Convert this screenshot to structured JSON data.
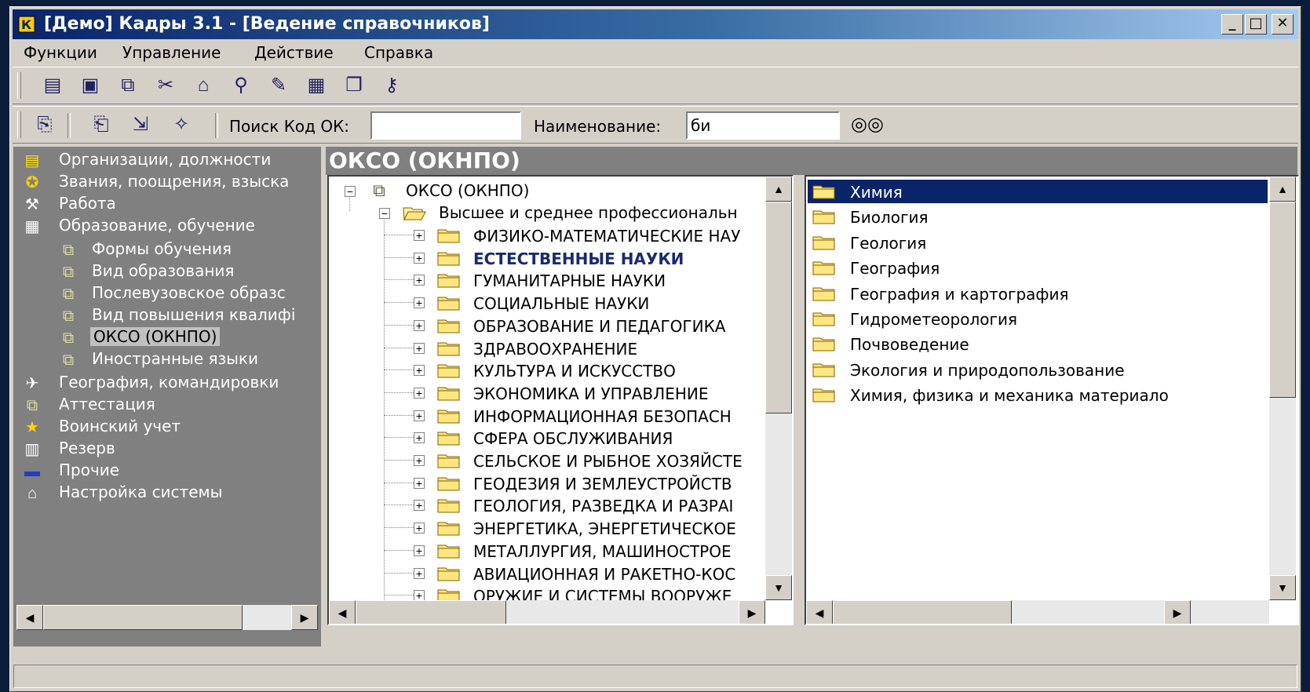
{
  "window": {
    "title": "[Демо] Кадры 3.1 - [Ведение справочников]",
    "minimize": "_",
    "maximize": "□",
    "close": "✕"
  },
  "menu": {
    "items": [
      "Функции",
      "Управление",
      "Действие",
      "Справка"
    ]
  },
  "search": {
    "code_label": "Поиск Код ОК:",
    "code_value": "",
    "name_label": "Наименование:",
    "name_value": "би"
  },
  "nav": {
    "items": [
      {
        "label": "Организации, должности",
        "icon": "org-icon"
      },
      {
        "label": "Звания, поощрения, взыска",
        "icon": "medal-icon"
      },
      {
        "label": "Работа",
        "icon": "work-icon"
      },
      {
        "label": "Образование, обучение",
        "icon": "education-icon"
      },
      {
        "label": "Формы обучения",
        "icon": "book-icon"
      },
      {
        "label": "Вид образования",
        "icon": "book-icon"
      },
      {
        "label": "Послевузовское образс",
        "icon": "book-icon"
      },
      {
        "label": "Вид повышения квалифі",
        "icon": "book-icon"
      },
      {
        "label": "ОКСО (ОКНПО)",
        "icon": "book-icon",
        "selected": true
      },
      {
        "label": "Иностранные языки",
        "icon": "book-icon"
      },
      {
        "label": "География, командировки",
        "icon": "plane-icon"
      },
      {
        "label": "Аттестация",
        "icon": "book-icon"
      },
      {
        "label": "Воинский учет",
        "icon": "star-icon"
      },
      {
        "label": "Резерв",
        "icon": "reserve-icon"
      },
      {
        "label": "Прочие",
        "icon": "window-icon"
      },
      {
        "label": "Настройка системы",
        "icon": "settings-icon"
      }
    ]
  },
  "panel": {
    "header": "ОКСО (ОКНПО)"
  },
  "tree": {
    "root": "ОКСО (ОКНПО)",
    "level1": "Высшее и среднее профессиональн",
    "items": [
      {
        "label": "ФИЗИКО-МАТЕМАТИЧЕСКИЕ НАУ",
        "bold": false
      },
      {
        "label": "ЕСТЕСТВЕННЫЕ НАУКИ",
        "bold": true
      },
      {
        "label": "ГУМАНИТАРНЫЕ НАУКИ",
        "bold": false
      },
      {
        "label": "СОЦИАЛЬНЫЕ НАУКИ",
        "bold": false
      },
      {
        "label": "ОБРАЗОВАНИЕ И ПЕДАГОГИКА",
        "bold": false
      },
      {
        "label": "ЗДРАВООХРАНЕНИЕ",
        "bold": false
      },
      {
        "label": "КУЛЬТУРА И ИСКУССТВО",
        "bold": false
      },
      {
        "label": "ЭКОНОМИКА И УПРАВЛЕНИЕ",
        "bold": false
      },
      {
        "label": "ИНФОРМАЦИОННАЯ БЕЗОПАСН",
        "bold": false
      },
      {
        "label": "СФЕРА ОБСЛУЖИВАНИЯ",
        "bold": false
      },
      {
        "label": "СЕЛЬСКОЕ И РЫБНОЕ ХОЗЯЙСТЕ",
        "bold": false
      },
      {
        "label": "ГЕОДЕЗИЯ И ЗЕМЛЕУСТРОЙСТВ",
        "bold": false
      },
      {
        "label": "ГЕОЛОГИЯ, РАЗВЕДКА И РАЗРАІ",
        "bold": false
      },
      {
        "label": "ЭНЕРГЕТИКА, ЭНЕРГЕТИЧЕСКОЕ",
        "bold": false
      },
      {
        "label": "МЕТАЛЛУРГИЯ, МАШИНОСТРОЕ",
        "bold": false
      },
      {
        "label": "АВИАЦИОННАЯ И РАКЕТНО-КОС",
        "bold": false
      },
      {
        "label": "ОРУЖИЕ И СИСТЕМЫ ВООРУЖЕ",
        "bold": false
      }
    ]
  },
  "list": {
    "items": [
      {
        "label": "Химия",
        "selected": true
      },
      {
        "label": "Биология"
      },
      {
        "label": "Геология"
      },
      {
        "label": "География"
      },
      {
        "label": "География и картография"
      },
      {
        "label": "Гидрометеорология"
      },
      {
        "label": "Почвоведение"
      },
      {
        "label": "Экология и природопользование"
      },
      {
        "label": "Химия, физика и механика материало"
      }
    ]
  },
  "colors": {
    "title_active": "#0a246a",
    "selection": "#0a246a",
    "panel_bg": "#808080",
    "face": "#d4d0c8"
  }
}
